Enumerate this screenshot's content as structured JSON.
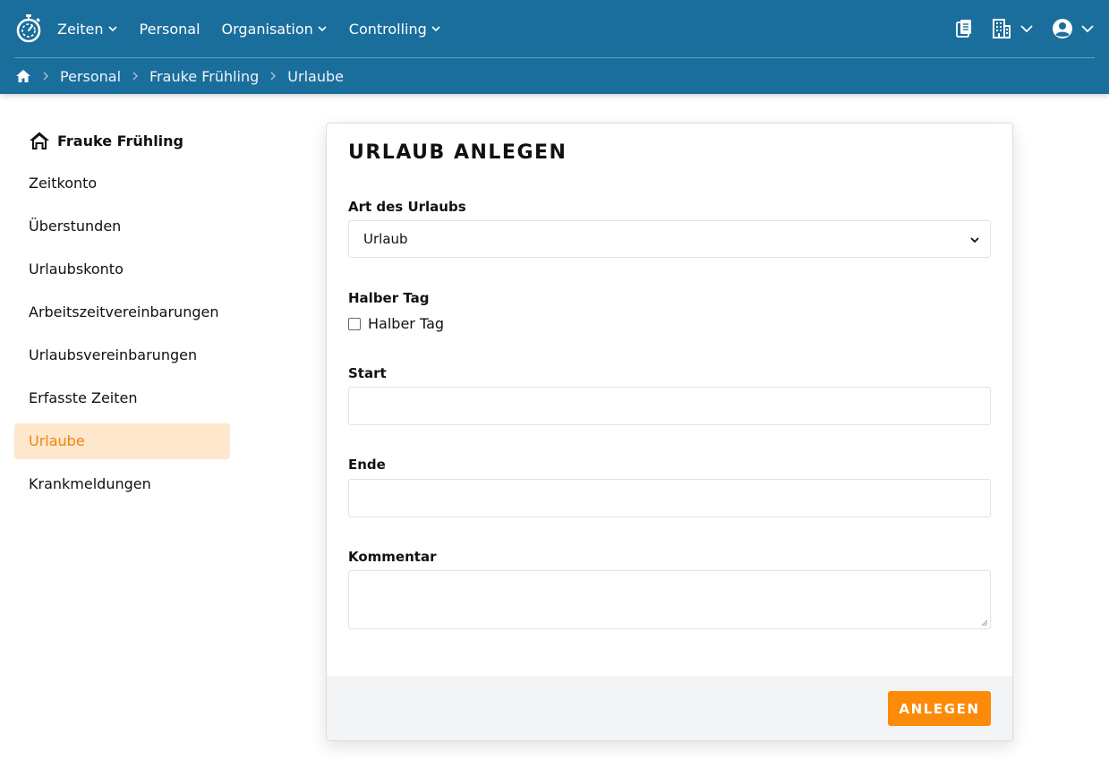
{
  "header": {
    "nav": [
      {
        "label": "Zeiten",
        "dropdown": true
      },
      {
        "label": "Personal",
        "dropdown": false
      },
      {
        "label": "Organisation",
        "dropdown": true
      },
      {
        "label": "Controlling",
        "dropdown": true
      }
    ],
    "icons": [
      "stopwatch-logo-icon",
      "clipboard-icon",
      "building-icon",
      "user-circle-icon"
    ]
  },
  "breadcrumb": {
    "home_icon": "home-icon",
    "items": [
      "Personal",
      "Frauke Frühling",
      "Urlaube"
    ]
  },
  "sidebar": {
    "title": "Frauke Frühling",
    "items": [
      {
        "label": "Zeitkonto",
        "active": false
      },
      {
        "label": "Überstunden",
        "active": false
      },
      {
        "label": "Urlaubskonto",
        "active": false
      },
      {
        "label": "Arbeitszeitvereinbarungen",
        "active": false
      },
      {
        "label": "Urlaubsvereinbarungen",
        "active": false
      },
      {
        "label": "Erfasste Zeiten",
        "active": false
      },
      {
        "label": "Urlaube",
        "active": true
      },
      {
        "label": "Krankmeldungen",
        "active": false
      }
    ]
  },
  "form": {
    "title": "URLAUB ANLEGEN",
    "type_label": "Art des Urlaubs",
    "type_value": "Urlaub",
    "halfday_label": "Halber Tag",
    "halfday_checkbox_label": "Halber Tag",
    "halfday_checked": false,
    "start_label": "Start",
    "start_value": "",
    "end_label": "Ende",
    "end_value": "",
    "comment_label": "Kommentar",
    "comment_value": "",
    "submit_label": "ANLEGEN"
  },
  "colors": {
    "header_bg": "#1a6e9c",
    "accent": "#fb8b09",
    "active_bg": "#fde7cd",
    "footer_bg": "#f2f4f6"
  }
}
